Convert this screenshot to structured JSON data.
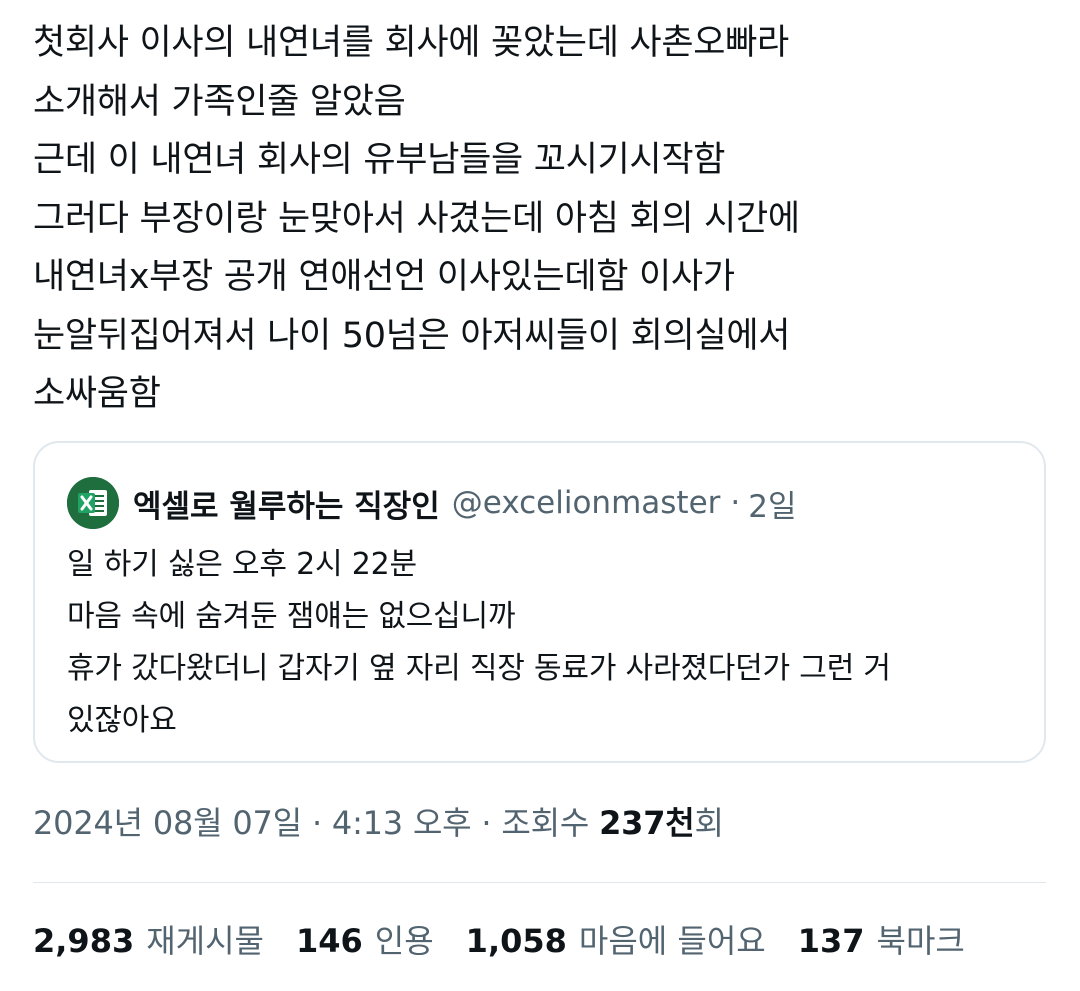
{
  "tweet": {
    "lines": [
      "첫회사 이사의 내연녀를 회사에 꽂았는데 사촌오빠라",
      "소개해서 가족인줄 알았음",
      "근데 이 내연녀 회사의 유부남들을 꼬시기시작함",
      "그러다 부장이랑 눈맞아서 사겼는데 아침 회의 시간에",
      "내연녀x부장 공개 연애선언 이사있는데함 이사가",
      "눈알뒤집어져서 나이 50넘은 아저씨들이 회의실에서",
      "소싸움함"
    ]
  },
  "quote": {
    "avatar_icon": "excel-icon",
    "name": "엑셀로 월루하는 직장인",
    "handle": "@excelionmaster",
    "separator": "·",
    "time": "2일",
    "lines": [
      "일 하기 싫은 오후 2시 22분",
      "마음 속에 숨겨둔 잼얘는 없으십니까",
      "휴가 갔다왔더니 갑자기 옆 자리 직장 동료가 사라졌다던가 그런 거",
      "있잖아요"
    ]
  },
  "meta": {
    "date": "2024년 08월 07일",
    "sep1": "·",
    "time": "4:13 오후",
    "sep2": "·",
    "views_label": "조회수",
    "views_count": "237천",
    "views_suffix": "회"
  },
  "stats": {
    "reposts": {
      "count": "2,983",
      "label": "재게시물"
    },
    "quotes": {
      "count": "146",
      "label": "인용"
    },
    "likes": {
      "count": "1,058",
      "label": "마음에 들어요"
    },
    "bookmarks": {
      "count": "137",
      "label": "북마크"
    }
  },
  "colors": {
    "text": "#0f1419",
    "secondary": "#536471",
    "border": "#e1e8ed",
    "excel_green": "#1e6e3e"
  }
}
